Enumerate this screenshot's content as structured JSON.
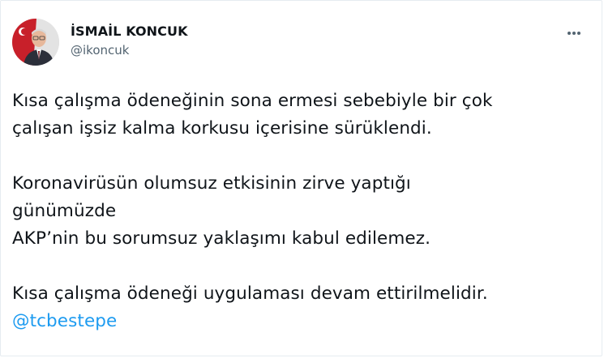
{
  "tweet": {
    "author": {
      "display_name": "İSMAİL KONCUK",
      "handle": "@ikoncuk",
      "avatar_icon": "profile-photo"
    },
    "more_icon": "ellipsis-icon",
    "text": {
      "paragraph1": {
        "line1": "Kısa çalışma ödeneğinin sona ermesi sebebiyle bir çok",
        "line2": "çalışan işsiz kalma korkusu içerisine sürüklendi."
      },
      "paragraph2": {
        "line1": "Koronavirüsün olumsuz etkisinin zirve yaptığı",
        "line2": "günümüzde",
        "line3": "AKP’nin bu sorumsuz yaklaşımı kabul edilemez."
      },
      "paragraph3": {
        "line1": "Kısa çalışma ödeneği uygulaması devam ettirilmelidir."
      },
      "mention": "@tcbestepe"
    }
  },
  "colors": {
    "text": "#0f1419",
    "secondary": "#536471",
    "link": "#1d9bf0",
    "border": "#e6ecf0"
  }
}
